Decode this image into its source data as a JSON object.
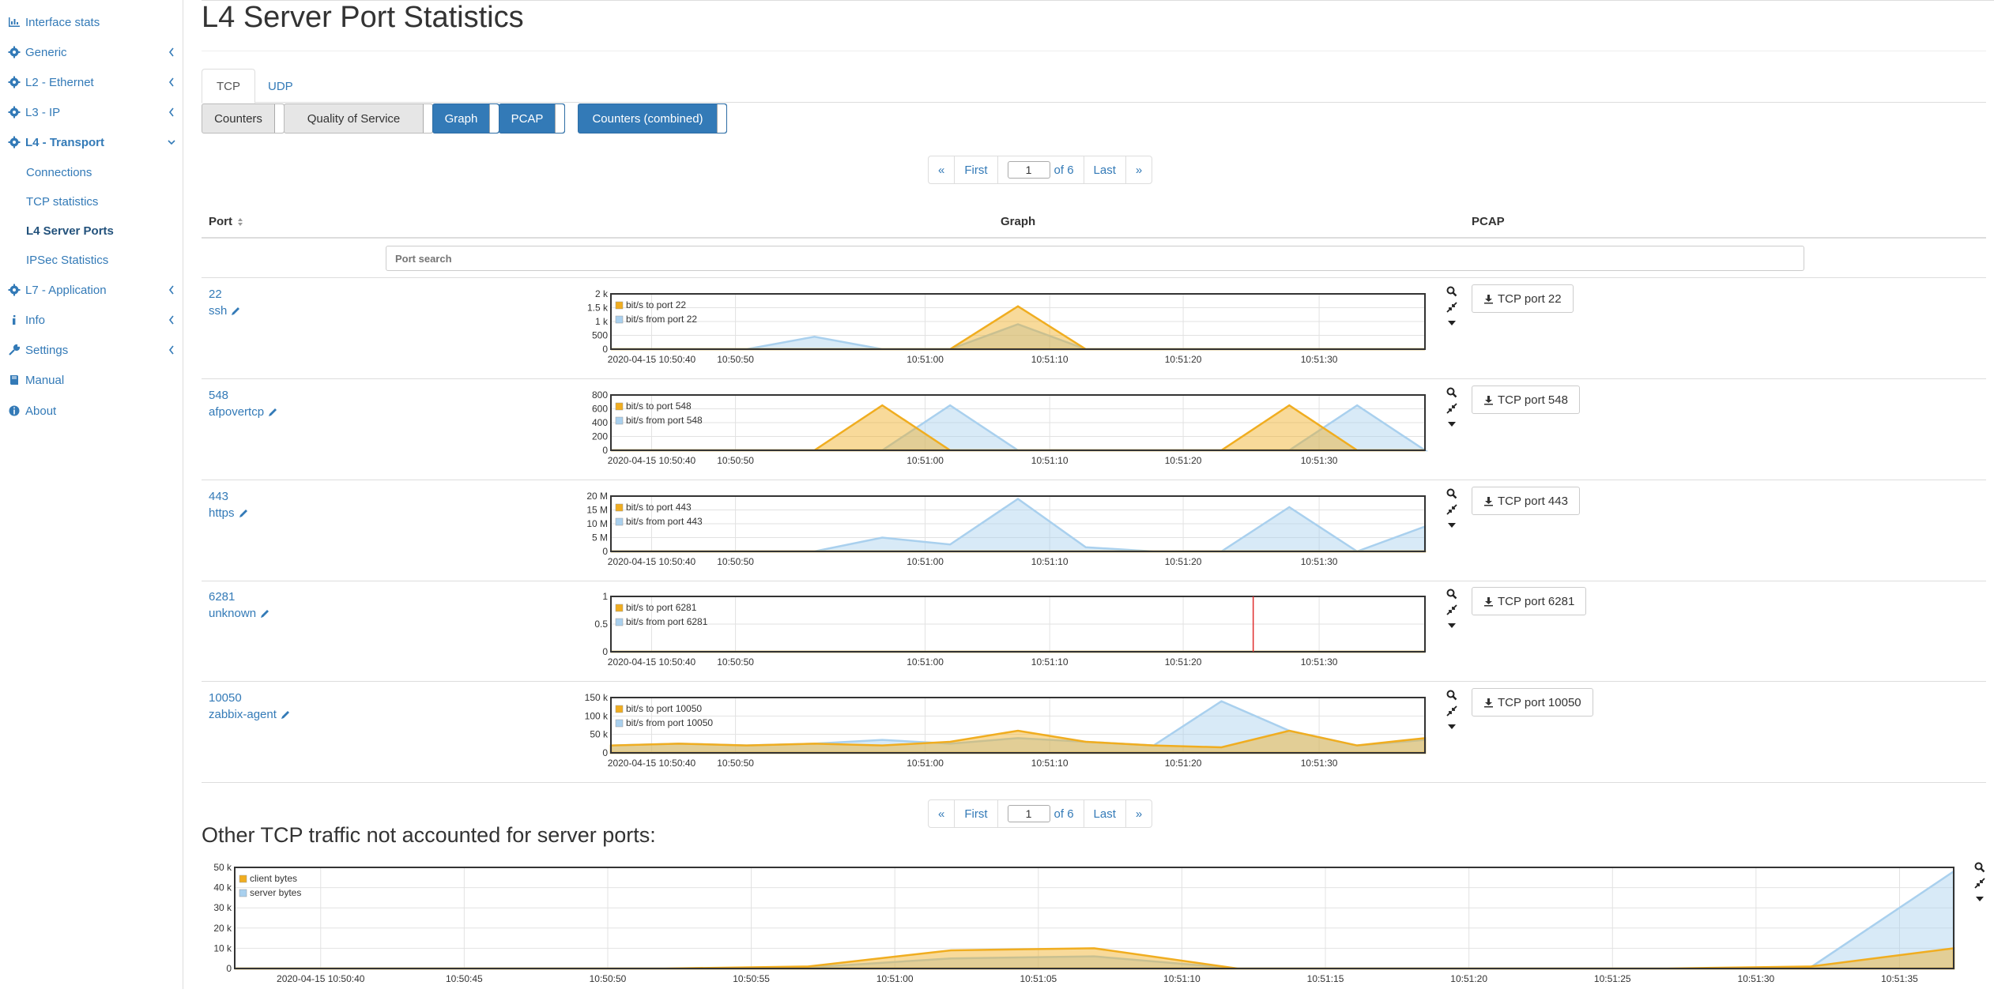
{
  "sidebar": {
    "items": [
      {
        "label": "Interface stats",
        "icon": "bar-chart-icon",
        "chevron": false
      },
      {
        "label": "Generic",
        "icon": "gear-icon",
        "chevron": true
      },
      {
        "label": "L2 - Ethernet",
        "icon": "gear-icon",
        "chevron": true
      },
      {
        "label": "L3 - IP",
        "icon": "gear-icon",
        "chevron": true
      },
      {
        "label": "L4 - Transport",
        "icon": "gear-icon",
        "chevron": true,
        "open": true
      },
      {
        "label": "L7 - Application",
        "icon": "gear-icon",
        "chevron": true
      },
      {
        "label": "Info",
        "icon": "info-icon",
        "chevron": true
      },
      {
        "label": "Settings",
        "icon": "wrench-icon",
        "chevron": true
      },
      {
        "label": "Manual",
        "icon": "book-icon",
        "chevron": false
      },
      {
        "label": "About",
        "icon": "info-icon",
        "chevron": false
      }
    ],
    "subitems": [
      "Connections",
      "TCP statistics",
      "L4 Server Ports",
      "IPSec Statistics"
    ],
    "active_sub": "L4 Server Ports"
  },
  "page": {
    "title": "L4 Server Port Statistics",
    "tabs": [
      "TCP",
      "UDP"
    ],
    "active_tab": "TCP",
    "toggles": [
      "Counters",
      "Quality of Service",
      "Graph",
      "PCAP",
      "Counters (combined)"
    ]
  },
  "pager": {
    "prev": "«",
    "first": "First",
    "page": "1",
    "of": "of 6",
    "last": "Last",
    "next": "»"
  },
  "table": {
    "headers": {
      "port": "Port",
      "graph": "Graph",
      "pcap": "PCAP"
    },
    "search_placeholder": "Port search",
    "rows": [
      {
        "port": "22",
        "service": "ssh",
        "pcap": "TCP port 22",
        "legend_to": "bit/s to port 22",
        "legend_from": "bit/s from port 22",
        "yticks": [
          "2 k",
          "1.5 k",
          "1 k",
          "500",
          "0"
        ]
      },
      {
        "port": "548",
        "service": "afpovertcp",
        "pcap": "TCP port 548",
        "legend_to": "bit/s to port 548",
        "legend_from": "bit/s from port 548",
        "yticks": [
          "800",
          "600",
          "400",
          "200",
          "0"
        ]
      },
      {
        "port": "443",
        "service": "https",
        "pcap": "TCP port 443",
        "legend_to": "bit/s to port 443",
        "legend_from": "bit/s from port 443",
        "yticks": [
          "20 M",
          "15 M",
          "10 M",
          "5 M",
          "0"
        ]
      },
      {
        "port": "6281",
        "service": "unknown",
        "pcap": "TCP port 6281",
        "legend_to": "bit/s to port 6281",
        "legend_from": "bit/s from port 6281",
        "yticks": [
          "1",
          "0.5",
          "0"
        ]
      },
      {
        "port": "10050",
        "service": "zabbix-agent",
        "pcap": "TCP port 10050",
        "legend_to": "bit/s to port 10050",
        "legend_from": "bit/s from port 10050",
        "yticks": [
          "150 k",
          "100 k",
          "50 k",
          "0"
        ]
      }
    ],
    "xticks": [
      "2020-04-15 10:50:40",
      "10:50:50",
      "10:51:00",
      "10:51:10",
      "10:51:20",
      "10:51:30"
    ]
  },
  "other": {
    "title": "Other TCP traffic not accounted for server ports:",
    "legend_client": "client bytes",
    "legend_server": "server bytes",
    "yticks": [
      "50 k",
      "40 k",
      "30 k",
      "20 k",
      "10 k",
      "0"
    ],
    "xticks": [
      "2020-04-15 10:50:40",
      "10:50:45",
      "10:50:50",
      "10:50:55",
      "10:51:00",
      "10:51:05",
      "10:51:10",
      "10:51:15",
      "10:51:20",
      "10:51:25",
      "10:51:30",
      "10:51:35"
    ]
  },
  "colors": {
    "to": "#f0ad20",
    "from": "#a9d0ee",
    "marker": "#e03030",
    "accent": "#337ab7"
  },
  "chart_data": [
    {
      "type": "area",
      "x_seconds": [
        0,
        5,
        10,
        15,
        20,
        25,
        30,
        35,
        40,
        45,
        50,
        55,
        60
      ],
      "series": [
        {
          "name": "bit/s to port 22",
          "values": [
            0,
            0,
            0,
            0,
            0,
            0,
            1550,
            0,
            0,
            0,
            0,
            0,
            0
          ]
        },
        {
          "name": "bit/s from port 22",
          "values": [
            0,
            0,
            0,
            450,
            0,
            0,
            900,
            0,
            0,
            0,
            0,
            0,
            0
          ]
        }
      ],
      "ylim": [
        0,
        2000
      ]
    },
    {
      "type": "area",
      "series": [
        {
          "name": "bit/s to port 548",
          "values": [
            0,
            0,
            0,
            0,
            650,
            0,
            0,
            0,
            0,
            0,
            650,
            0,
            0
          ]
        },
        {
          "name": "bit/s from port 548",
          "values": [
            0,
            0,
            0,
            0,
            0,
            650,
            0,
            0,
            0,
            0,
            0,
            650,
            0
          ]
        }
      ],
      "ylim": [
        0,
        800
      ]
    },
    {
      "type": "area",
      "series": [
        {
          "name": "bit/s to port 443",
          "values": [
            0,
            0,
            0,
            0,
            0,
            300,
            0,
            0,
            0,
            0,
            0,
            0,
            1000
          ]
        },
        {
          "name": "bit/s from port 443",
          "values": [
            0,
            0,
            0,
            0,
            5000000,
            2500000,
            19000000,
            1500000,
            0,
            0,
            16000000,
            0,
            9000000
          ]
        }
      ],
      "ylim": [
        0,
        20000000
      ]
    },
    {
      "type": "area",
      "series": [
        {
          "name": "bit/s to port 6281",
          "values": [
            0,
            0,
            0,
            0,
            0,
            0,
            0,
            0,
            0,
            0,
            0,
            0,
            0
          ]
        },
        {
          "name": "bit/s from port 6281",
          "values": [
            0,
            0,
            0,
            0,
            0,
            0,
            0,
            0,
            0,
            0,
            0,
            0,
            0
          ]
        }
      ],
      "ylim": [
        0,
        1
      ]
    },
    {
      "type": "area",
      "series": [
        {
          "name": "bit/s to port 10050",
          "values": [
            20000,
            25000,
            20000,
            25000,
            20000,
            30000,
            60000,
            30000,
            20000,
            15000,
            60000,
            20000,
            40000
          ]
        },
        {
          "name": "bit/s from port 10050",
          "values": [
            20000,
            25000,
            20000,
            25000,
            35000,
            25000,
            40000,
            30000,
            20000,
            140000,
            60000,
            20000,
            35000
          ]
        }
      ],
      "ylim": [
        0,
        150000
      ]
    },
    {
      "type": "area",
      "series": [
        {
          "name": "client bytes",
          "values": [
            0,
            0,
            0,
            0,
            1000,
            9000,
            10000,
            0,
            0,
            0,
            0,
            1000,
            10000
          ]
        },
        {
          "name": "server bytes",
          "values": [
            0,
            0,
            0,
            0,
            500,
            5000,
            6000,
            0,
            0,
            0,
            0,
            500,
            48000
          ]
        }
      ],
      "ylim": [
        0,
        50000
      ]
    }
  ]
}
